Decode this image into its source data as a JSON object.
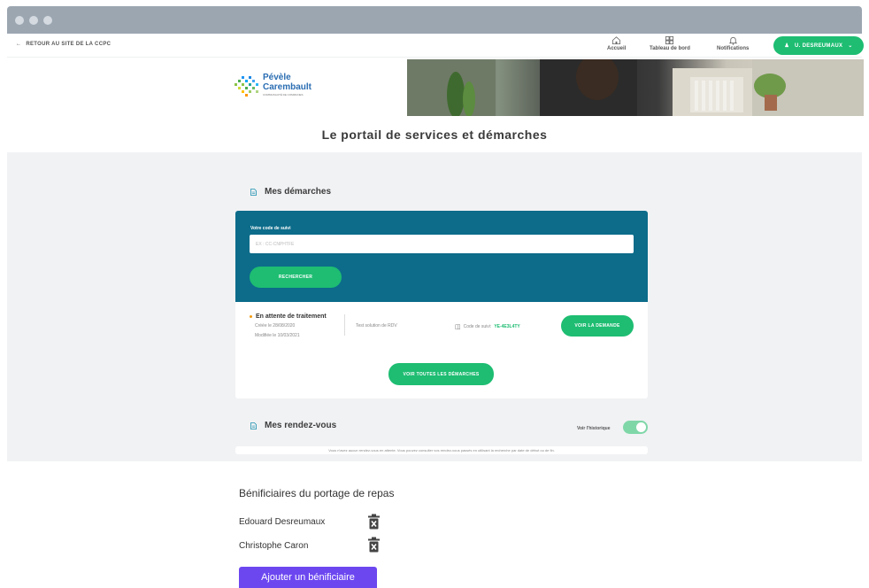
{
  "topnav": {
    "back_label": "RETOUR AU SITE DE LA CCPC",
    "items": [
      {
        "label": "Accueil",
        "icon": "home-icon"
      },
      {
        "label": "Tableau de bord",
        "icon": "dashboard-icon"
      },
      {
        "label": "Notifications",
        "icon": "bell-icon"
      }
    ],
    "user_label": "U. DESREUMAUX"
  },
  "banner": {
    "logo_line1": "Pévèle",
    "logo_line2": "Carembault",
    "logo_sub": "COMMUNAUTÉ DE COMMUNES"
  },
  "page_title": "Le portail de services et démarches",
  "demarches": {
    "title": "Mes démarches",
    "search_label": "Votre code de suivi",
    "search_placeholder": "EX : CC-CNPHTFE",
    "search_button": "RECHERCHER",
    "request": {
      "status": "En attente de traitement",
      "created": "Créée le 28/08/2020",
      "modified": "Modifiée le 10/03/2021",
      "description": "Test solution de RDV",
      "code_label": "Code de suivi:",
      "code_value": "YE-4E3L4TY",
      "view_button": "VOIR LA DEMANDE"
    },
    "all_button": "VOIR TOUTES LES DÉMARCHES"
  },
  "rdv": {
    "title": "Mes rendez-vous",
    "history_label": "Voir l'historique",
    "history_on": true,
    "empty_text": "Vous n'avez aucun rendez-vous en attente. Vous pouvez consulter vos rendez-vous passés en utilisant la recherche par date de début ou de fin."
  },
  "beneficiaires": {
    "title": "Bénificiaires du portage de repas",
    "items": [
      "Edouard Desreumaux",
      "Christophe Caron"
    ],
    "add_button": "Ajouter un bénificiaire"
  },
  "colors": {
    "accent_green": "#1ebd72",
    "panel_blue": "#0c6c8a",
    "purple": "#6c47f0"
  }
}
